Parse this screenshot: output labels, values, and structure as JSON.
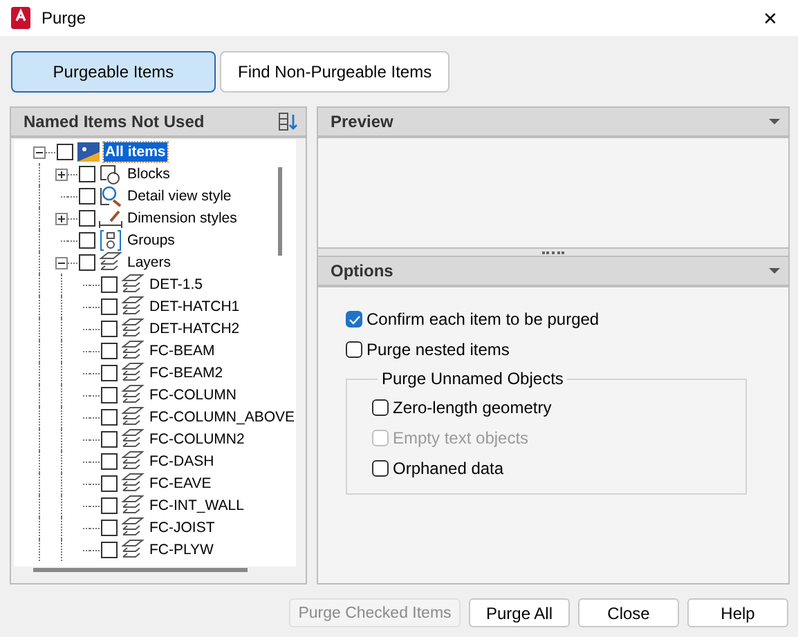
{
  "window": {
    "title": "Purge",
    "close": "✕"
  },
  "tabs": [
    {
      "label": "Purgeable Items",
      "selected": true
    },
    {
      "label": "Find Non-Purgeable Items",
      "selected": false
    }
  ],
  "tree_panel": {
    "title": "Named Items Not Used",
    "items": [
      {
        "label": "All items",
        "kind": "all",
        "checked": false,
        "selected": true,
        "expanded": true,
        "children": [
          {
            "label": "Blocks",
            "kind": "block",
            "checked": false,
            "selected": false,
            "expanded": false
          },
          {
            "label": "Detail view style",
            "kind": "detail",
            "checked": false,
            "selected": false
          },
          {
            "label": "Dimension styles",
            "kind": "dimension",
            "checked": false,
            "selected": false,
            "expanded": false
          },
          {
            "label": "Groups",
            "kind": "group",
            "checked": false,
            "selected": false
          },
          {
            "label": "Layers",
            "kind": "layer",
            "checked": false,
            "selected": false,
            "expanded": true,
            "children": [
              {
                "label": "DET-1.5",
                "kind": "layer",
                "checked": false,
                "selected": false
              },
              {
                "label": "DET-HATCH1",
                "kind": "layer",
                "checked": false,
                "selected": false
              },
              {
                "label": "DET-HATCH2",
                "kind": "layer",
                "checked": false,
                "selected": false
              },
              {
                "label": "FC-BEAM",
                "kind": "layer",
                "checked": false,
                "selected": false
              },
              {
                "label": "FC-BEAM2",
                "kind": "layer",
                "checked": false,
                "selected": false
              },
              {
                "label": "FC-COLUMN",
                "kind": "layer",
                "checked": false,
                "selected": false
              },
              {
                "label": "FC-COLUMN_ABOVE",
                "kind": "layer",
                "checked": false,
                "selected": false
              },
              {
                "label": "FC-COLUMN2",
                "kind": "layer",
                "checked": false,
                "selected": false
              },
              {
                "label": "FC-DASH",
                "kind": "layer",
                "checked": false,
                "selected": false
              },
              {
                "label": "FC-EAVE",
                "kind": "layer",
                "checked": false,
                "selected": false
              },
              {
                "label": "FC-INT_WALL",
                "kind": "layer",
                "checked": false,
                "selected": false
              },
              {
                "label": "FC-JOIST",
                "kind": "layer",
                "checked": false,
                "selected": false
              },
              {
                "label": "FC-PLYW",
                "kind": "layer",
                "checked": false,
                "selected": false
              }
            ]
          }
        ]
      }
    ]
  },
  "preview": {
    "title": "Preview"
  },
  "options": {
    "title": "Options",
    "items": [
      {
        "label": "Confirm each item to be purged",
        "checked": true,
        "disabled": false
      },
      {
        "label": "Purge nested items",
        "checked": false,
        "disabled": false
      }
    ],
    "group": {
      "title": "Purge Unnamed Objects",
      "items": [
        {
          "label": "Zero-length geometry",
          "checked": false,
          "disabled": false
        },
        {
          "label": "Empty text objects",
          "checked": false,
          "disabled": true
        },
        {
          "label": "Orphaned data",
          "checked": false,
          "disabled": false
        }
      ]
    }
  },
  "buttons": [
    {
      "label": "Purge Checked Items",
      "disabled": true
    },
    {
      "label": "Purge All",
      "disabled": false
    },
    {
      "label": "Close",
      "disabled": false
    },
    {
      "label": "Help",
      "disabled": false
    }
  ]
}
